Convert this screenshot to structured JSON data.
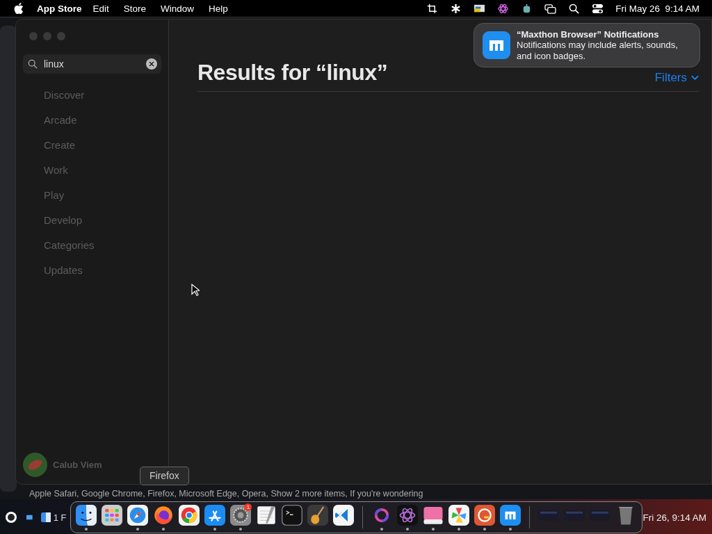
{
  "menu_bar": {
    "app_name": "App Store",
    "menus": [
      "Edit",
      "Store",
      "Window",
      "Help"
    ],
    "clock": "Fri May 26  9:14 AM"
  },
  "window": {
    "search": {
      "value": "linux"
    },
    "sidebar": {
      "items": [
        {
          "label": "Discover",
          "selected": false
        },
        {
          "label": "Arcade",
          "selected": false
        },
        {
          "label": "Create",
          "selected": false
        },
        {
          "label": "Work",
          "selected": false
        },
        {
          "label": "Play",
          "selected": false
        },
        {
          "label": "Develop",
          "selected": false
        },
        {
          "label": "Categories",
          "selected": false
        },
        {
          "label": "Updates",
          "selected": false
        }
      ],
      "account": "Calub Viem"
    },
    "heading": "Results for “linux”",
    "filters": "Filters"
  },
  "notification": {
    "title": "“Maxthon Browser” Notifications",
    "body": "Notifications may include alerts, sounds, and icon badges."
  },
  "background_text": "Apple Safari, Google Chrome, Firefox, Microsoft Edge, Opera, Show 2 more items, If you're wondering",
  "tooltip": "Firefox",
  "taskbar": {
    "window_label": "1 F",
    "clock": "Fri 26, 9:14 AM"
  },
  "dock": [
    {
      "kind": "finder",
      "running": true
    },
    {
      "kind": "launchpad",
      "running": false
    },
    {
      "kind": "safari",
      "running": true
    },
    {
      "kind": "firefox",
      "running": true
    },
    {
      "kind": "chrome",
      "running": false
    },
    {
      "kind": "appstore",
      "running": true
    },
    {
      "kind": "settings",
      "running": true,
      "badge": "1"
    },
    {
      "kind": "textedit",
      "running": false
    },
    {
      "kind": "terminal",
      "running": false
    },
    {
      "kind": "guitar",
      "running": false
    },
    {
      "kind": "vscode",
      "running": false
    },
    {
      "kind": "separator"
    },
    {
      "kind": "ring",
      "running": true
    },
    {
      "kind": "atom",
      "running": true
    },
    {
      "kind": "monitor",
      "running": true
    },
    {
      "kind": "pinwheel",
      "running": true
    },
    {
      "kind": "duck",
      "running": true
    },
    {
      "kind": "maxthon",
      "running": true
    },
    {
      "kind": "separator"
    },
    {
      "kind": "thumbnail",
      "running": false
    },
    {
      "kind": "thumbnail",
      "running": false
    },
    {
      "kind": "thumbnail",
      "running": false
    },
    {
      "kind": "trash",
      "running": false
    }
  ]
}
